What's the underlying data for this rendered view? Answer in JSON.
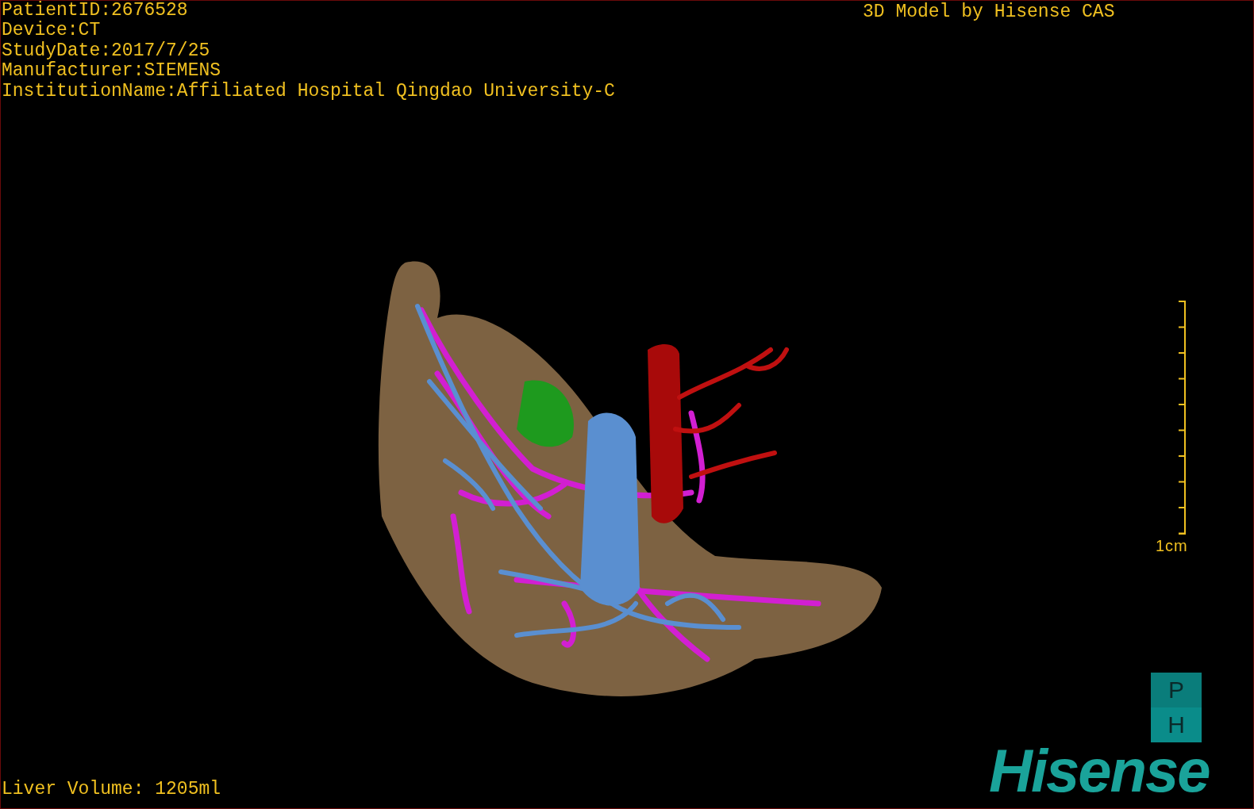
{
  "patient_info": [
    "PatientID:2676528",
    "Device:CT",
    "StudyDate:2017/7/25",
    "Manufacturer:SIEMENS",
    "InstitutionName:Affiliated Hospital Qingdao University-C"
  ],
  "title": "3D Model by Hisense CAS",
  "scale_bar": {
    "label": "1cm"
  },
  "orientation_cube": {
    "top": "P",
    "bottom": "H"
  },
  "logo": "Hisense",
  "liver_volume": "Liver Volume: 1205ml"
}
